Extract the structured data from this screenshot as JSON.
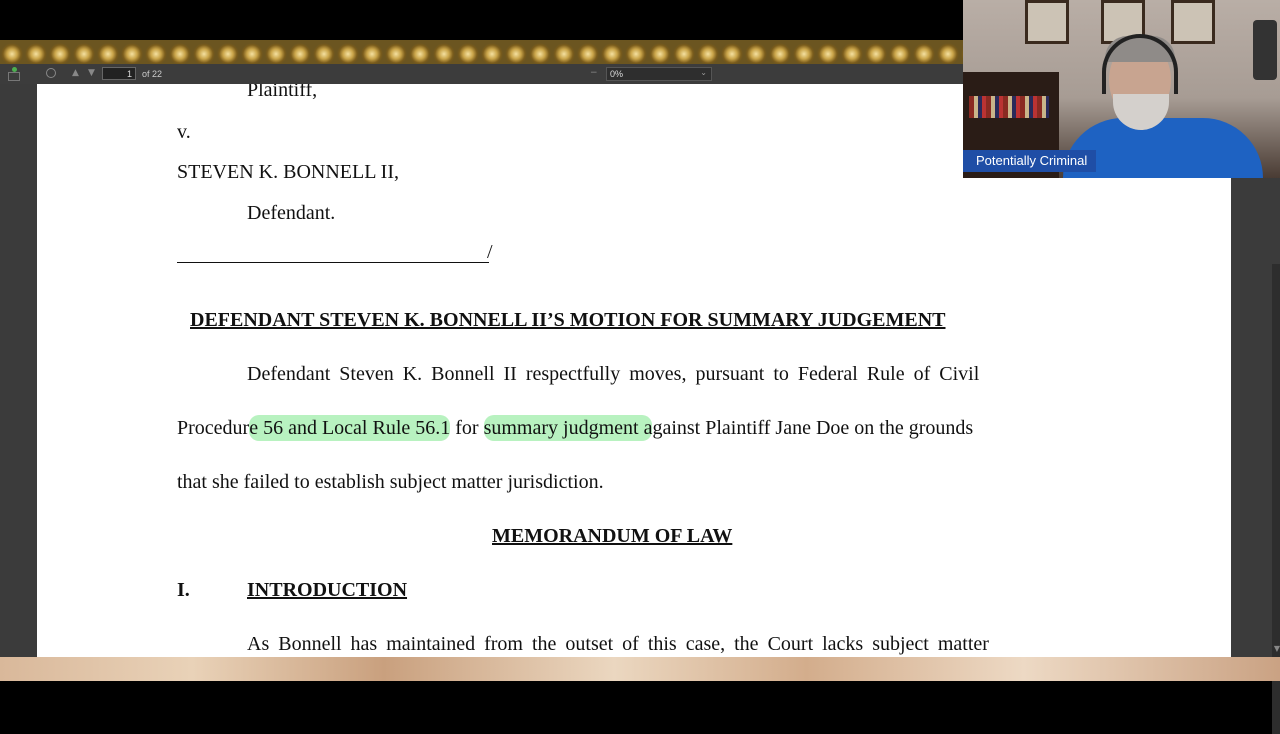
{
  "toolbar": {
    "page_number": "1",
    "page_count": "of 22",
    "zoom": "0%"
  },
  "document": {
    "plaintiff_label": "Plaintiff,",
    "versus": "v.",
    "defendant_name": "STEVEN K. BONNELL II,",
    "defendant_label": "Defendant.",
    "signature_slash": "/",
    "motion_title": "DEFENDANT STEVEN K. BONNELL II’S MOTION FOR SUMMARY JUDGEMENT",
    "para1": {
      "line1": "Defendant Steven K. Bonnell II respectfully moves, pursuant to Federal Rule of Civil",
      "line2_a": "Procedur",
      "line2_hl1": "e 56 and Local Rule 56.1",
      "line2_b": " for ",
      "line2_hl2": "summary judgment a",
      "line2_c": "gainst Plaintiff Jane Doe on the grounds",
      "line3": "that she failed to establish subject matter jurisdiction."
    },
    "memo_heading": "MEMORANDUM OF LAW",
    "intro_number": "I.",
    "intro_heading": "INTRODUCTION",
    "para2_line1": "As Bonnell has maintained from the outset of this case, the Court lacks subject matter"
  },
  "webcam": {
    "caption": "Potentially Criminal"
  },
  "colors": {
    "highlight": "#b8f2c0",
    "caption_bg": "#1f4ea6",
    "toolbar_bg": "#3c3c3c"
  }
}
